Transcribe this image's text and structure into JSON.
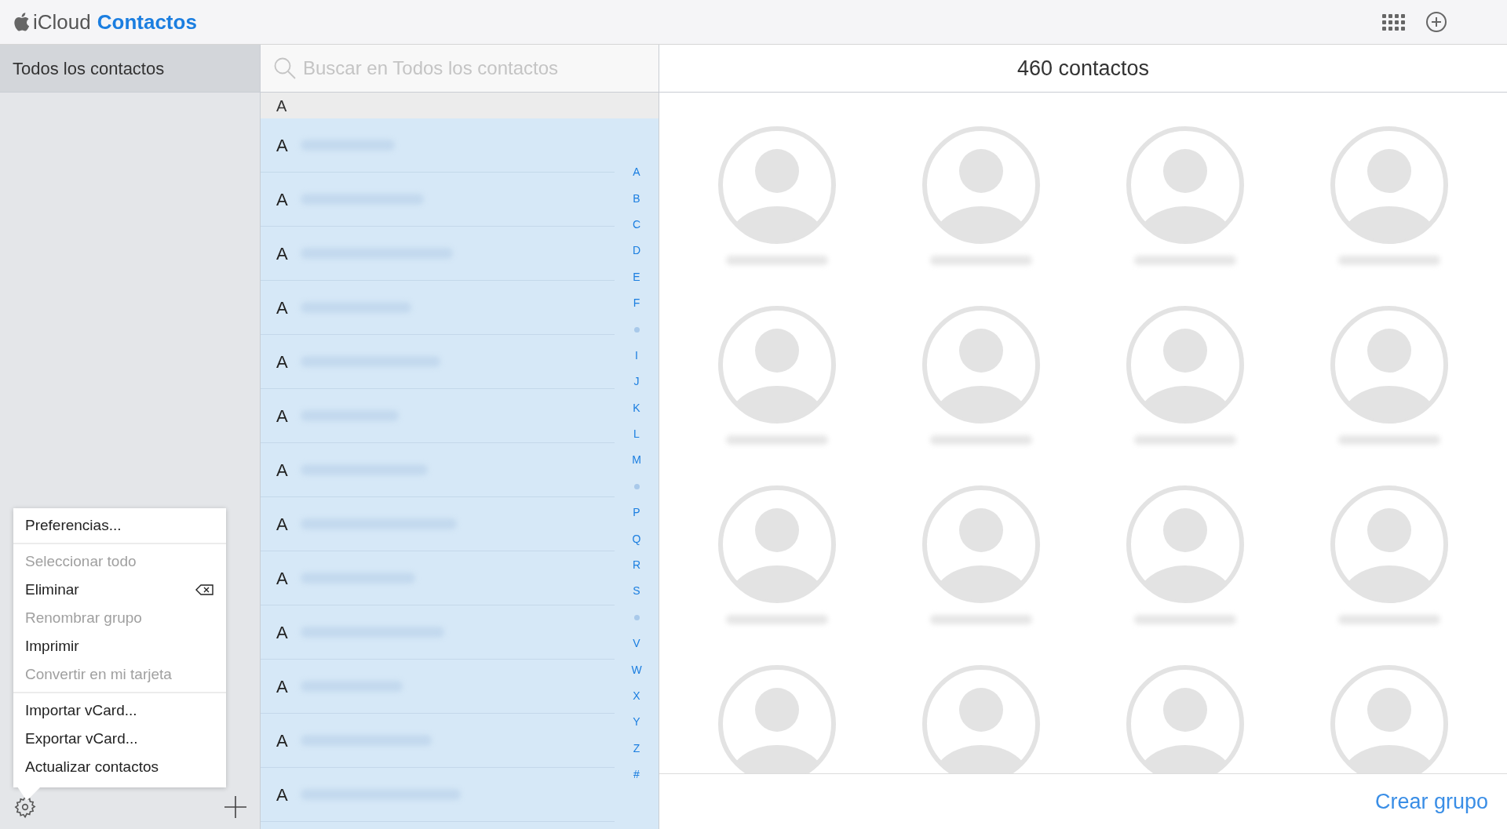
{
  "header": {
    "brand": "iCloud",
    "app": "Contactos"
  },
  "sidebar": {
    "groups": [
      {
        "label": "Todos los contactos",
        "selected": true
      }
    ]
  },
  "menu": {
    "sections": [
      [
        {
          "label": "Preferencias...",
          "disabled": false,
          "shortcut": false
        }
      ],
      [
        {
          "label": "Seleccionar todo",
          "disabled": true,
          "shortcut": false
        },
        {
          "label": "Eliminar",
          "disabled": false,
          "shortcut": true
        },
        {
          "label": "Renombrar grupo",
          "disabled": true,
          "shortcut": false
        },
        {
          "label": "Imprimir",
          "disabled": false,
          "shortcut": false
        },
        {
          "label": "Convertir en mi tarjeta",
          "disabled": true,
          "shortcut": false
        }
      ],
      [
        {
          "label": "Importar vCard...",
          "disabled": false,
          "shortcut": false
        },
        {
          "label": "Exportar vCard...",
          "disabled": false,
          "shortcut": false
        },
        {
          "label": "Actualizar contactos",
          "disabled": false,
          "shortcut": false
        }
      ]
    ]
  },
  "search": {
    "placeholder": "Buscar en Todos los contactos"
  },
  "list": {
    "section": "A",
    "rows": [
      {
        "initial": "A",
        "selected": true
      },
      {
        "initial": "A",
        "selected": true
      },
      {
        "initial": "A",
        "selected": true
      },
      {
        "initial": "A",
        "selected": true
      },
      {
        "initial": "A",
        "selected": true
      },
      {
        "initial": "A",
        "selected": true
      },
      {
        "initial": "A",
        "selected": true
      },
      {
        "initial": "A",
        "selected": true
      },
      {
        "initial": "A",
        "selected": true
      },
      {
        "initial": "A",
        "selected": true
      },
      {
        "initial": "A",
        "selected": true
      },
      {
        "initial": "A",
        "selected": true
      },
      {
        "initial": "A",
        "selected": true
      }
    ],
    "index": [
      {
        "kind": "letter",
        "label": "A"
      },
      {
        "kind": "letter",
        "label": "B"
      },
      {
        "kind": "letter",
        "label": "C"
      },
      {
        "kind": "letter",
        "label": "D"
      },
      {
        "kind": "letter",
        "label": "E"
      },
      {
        "kind": "letter",
        "label": "F"
      },
      {
        "kind": "dot"
      },
      {
        "kind": "letter",
        "label": "I"
      },
      {
        "kind": "letter",
        "label": "J"
      },
      {
        "kind": "letter",
        "label": "K"
      },
      {
        "kind": "letter",
        "label": "L"
      },
      {
        "kind": "letter",
        "label": "M"
      },
      {
        "kind": "dot"
      },
      {
        "kind": "letter",
        "label": "P"
      },
      {
        "kind": "letter",
        "label": "Q"
      },
      {
        "kind": "letter",
        "label": "R"
      },
      {
        "kind": "letter",
        "label": "S"
      },
      {
        "kind": "dot"
      },
      {
        "kind": "letter",
        "label": "V"
      },
      {
        "kind": "letter",
        "label": "W"
      },
      {
        "kind": "letter",
        "label": "X"
      },
      {
        "kind": "letter",
        "label": "Y"
      },
      {
        "kind": "letter",
        "label": "Z"
      },
      {
        "kind": "letter",
        "label": "#"
      }
    ]
  },
  "detail": {
    "count": "460 contactos"
  },
  "footer": {
    "link": "Crear grupo"
  }
}
